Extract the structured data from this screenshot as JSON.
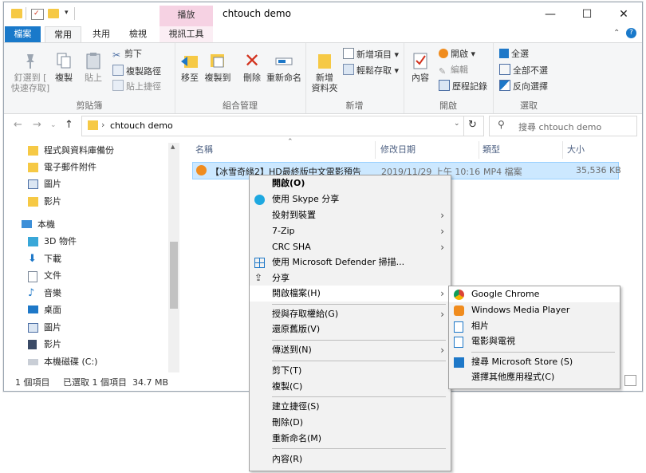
{
  "window": {
    "title": "chtouch demo",
    "contextual_tab_header": "播放",
    "controls": {
      "minimize": "—",
      "maximize": "☐",
      "close": "✕"
    }
  },
  "ribbon": {
    "tabs": [
      "檔案",
      "常用",
      "共用",
      "檢視",
      "視訊工具"
    ],
    "groups": {
      "clipboard": {
        "label": "剪貼簿",
        "pin": "釘選到 [\n快速存取]",
        "copy": "複製",
        "paste": "貼上",
        "cut": "剪下",
        "copy_path": "複製路徑",
        "paste_shortcut": "貼上捷徑"
      },
      "organize": {
        "label": "組合管理",
        "move_to": "移至",
        "copy_to": "複製到",
        "delete": "刪除",
        "rename": "重新命名"
      },
      "new": {
        "label": "新增",
        "new_folder": "新增\n資料夾",
        "new_item": "新增項目 ▾",
        "easy_access": "輕鬆存取 ▾"
      },
      "open": {
        "label": "開啟",
        "properties": "內容",
        "open": "開啟 ▾",
        "edit": "編輯",
        "history": "歷程記錄"
      },
      "select": {
        "label": "選取",
        "select_all": "全選",
        "select_none": "全部不選",
        "invert": "反向選擇"
      }
    }
  },
  "address": {
    "path": "chtouch demo",
    "search_placeholder": "搜尋 chtouch demo"
  },
  "nav_pane": {
    "items": [
      {
        "label": "程式與資料庫備份",
        "icon": "folder-icon"
      },
      {
        "label": "電子郵件附件",
        "icon": "folder-icon"
      },
      {
        "label": "圖片",
        "icon": "pictures-icon"
      },
      {
        "label": "影片",
        "icon": "folder-icon"
      },
      {
        "label": "本機",
        "icon": "computer-icon"
      },
      {
        "label": "3D 物件",
        "icon": "3d-objects-icon"
      },
      {
        "label": "下載",
        "icon": "download-icon"
      },
      {
        "label": "文件",
        "icon": "documents-icon"
      },
      {
        "label": "音樂",
        "icon": "music-icon"
      },
      {
        "label": "桌面",
        "icon": "desktop-icon"
      },
      {
        "label": "圖片",
        "icon": "pictures-icon"
      },
      {
        "label": "影片",
        "icon": "videos-icon"
      },
      {
        "label": "本機磁碟 (C:)",
        "icon": "drive-icon"
      }
    ]
  },
  "file_list": {
    "columns": [
      "名稱",
      "修改日期",
      "類型",
      "大小"
    ],
    "rows": [
      {
        "name": "【冰雪奇緣2】HD最終版中文電影預告",
        "modified": "2019/11/29 上午 10:16",
        "type": "MP4 檔案",
        "size": "35,536 KB"
      }
    ]
  },
  "status_bar": {
    "count": "1 個項目",
    "selected": "已選取 1 個項目  34.7 MB"
  },
  "context_menu": {
    "items": [
      {
        "label": "開啟(O)",
        "bold": true
      },
      {
        "label": "使用 Skype 分享",
        "icon": "skype-icon"
      },
      {
        "label": "投射到裝置",
        "submenu": true
      },
      {
        "label": "7-Zip",
        "submenu": true
      },
      {
        "label": "CRC SHA",
        "submenu": true
      },
      {
        "label": "使用 Microsoft Defender 掃描...",
        "icon": "defender-icon"
      },
      {
        "label": "分享",
        "icon": "share-icon"
      },
      {
        "label": "開啟檔案(H)",
        "submenu": true,
        "highlighted": true
      },
      {
        "label": "授與存取權給(G)",
        "submenu": true
      },
      {
        "label": "還原舊版(V)"
      },
      {
        "label": "傳送到(N)",
        "submenu": true
      },
      {
        "label": "剪下(T)"
      },
      {
        "label": "複製(C)"
      },
      {
        "label": "建立捷徑(S)"
      },
      {
        "label": "刪除(D)"
      },
      {
        "label": "重新命名(M)"
      },
      {
        "label": "內容(R)"
      }
    ]
  },
  "open_with_submenu": {
    "items": [
      {
        "label": "Google Chrome",
        "icon": "chrome-icon"
      },
      {
        "label": "Windows Media Player",
        "icon": "media-player-icon"
      },
      {
        "label": "相片",
        "icon": "photos-icon"
      },
      {
        "label": "電影與電視",
        "icon": "movies-tv-icon"
      },
      {
        "label": "搜尋 Microsoft Store (S)",
        "icon": "store-icon"
      },
      {
        "label": "選擇其他應用程式(C)"
      }
    ]
  },
  "colors": {
    "file_tab": "#1979ca",
    "selection": "#cce8ff",
    "contextual_tab": "#f6d2e3",
    "folder": "#f6c945"
  }
}
